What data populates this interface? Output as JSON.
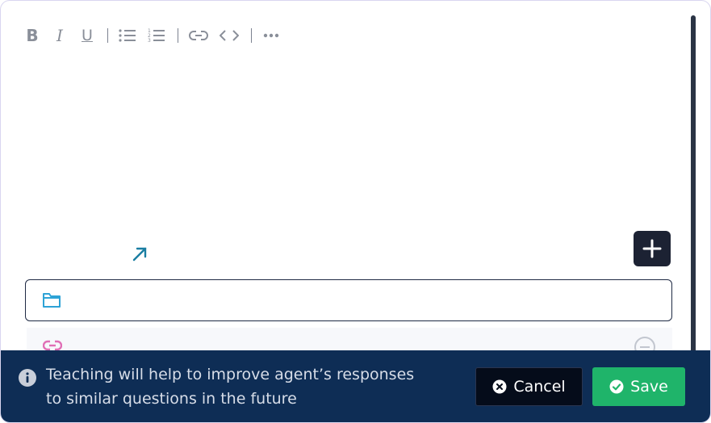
{
  "toolbar": {
    "items": [
      "bold-icon",
      "italic-icon",
      "underline-icon",
      "bulleted-list-icon",
      "numbered-list-icon",
      "link-icon",
      "code-icon",
      "more-icon"
    ],
    "bold_label": "B",
    "italic_label": "I",
    "underline_label": "U"
  },
  "editor": {
    "content": ""
  },
  "actions": {
    "external_link_icon": "arrow-up-right-icon",
    "add_icon": "plus-icon"
  },
  "folder_field": {
    "icon": "folder-icon",
    "value": ""
  },
  "link_row": {
    "icon": "link-icon",
    "remove_icon": "minus-circle-icon"
  },
  "footer": {
    "info_text": "Teaching will help to improve agent’s responses to similar questions in the future",
    "cancel_label": "Cancel",
    "save_label": "Save"
  },
  "colors": {
    "footer_bg": "#0e2d55",
    "save_bg": "#1fb46a",
    "cancel_bg": "#050c1a",
    "add_button_bg": "#1c2233",
    "accent_link": "#1a7ea2",
    "folder_icon": "#2ea3d6",
    "link_icon": "#e06fb6"
  }
}
